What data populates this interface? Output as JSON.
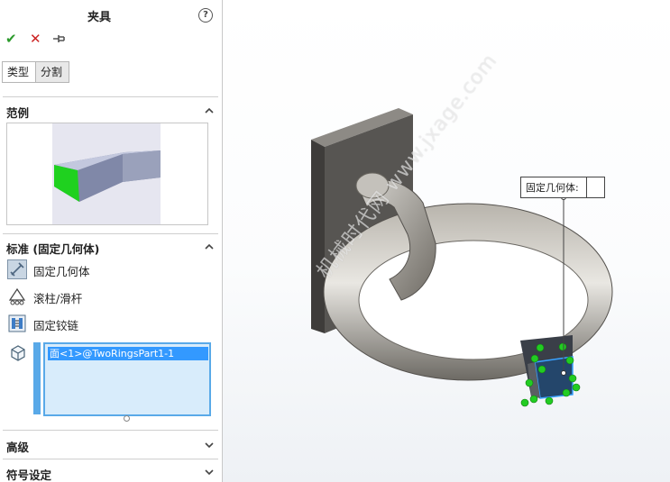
{
  "panel": {
    "title": "夹具",
    "help_icon": "?",
    "toolbar": {
      "ok_icon": "✔",
      "cancel_icon": "✕",
      "pin_icon": "pushpin-icon"
    },
    "tabs": [
      {
        "label": "类型",
        "active": true
      },
      {
        "label": "分割",
        "active": false
      }
    ],
    "sections": {
      "example": {
        "title": "范例"
      },
      "standard": {
        "title": "标准 (固定几何体)",
        "options": [
          {
            "label": "固定几何体",
            "icon": "fixed-geometry-icon",
            "selected": true
          },
          {
            "label": "滚柱/滑杆",
            "icon": "roller-slider-icon"
          },
          {
            "label": "固定铰链",
            "icon": "fixed-hinge-icon"
          }
        ],
        "selection": {
          "items": [
            "面<1>@TwoRingsPart1-1"
          ]
        }
      },
      "advanced": {
        "title": "高级"
      },
      "symbol": {
        "title": "符号设定"
      }
    }
  },
  "viewport": {
    "callout_label": "固定几何体:",
    "watermark": "机械时代网 www.jxage.com"
  },
  "colors": {
    "accent": "#59a9e8",
    "selection": "#3399ff",
    "fixture_green": "#22cc22"
  }
}
